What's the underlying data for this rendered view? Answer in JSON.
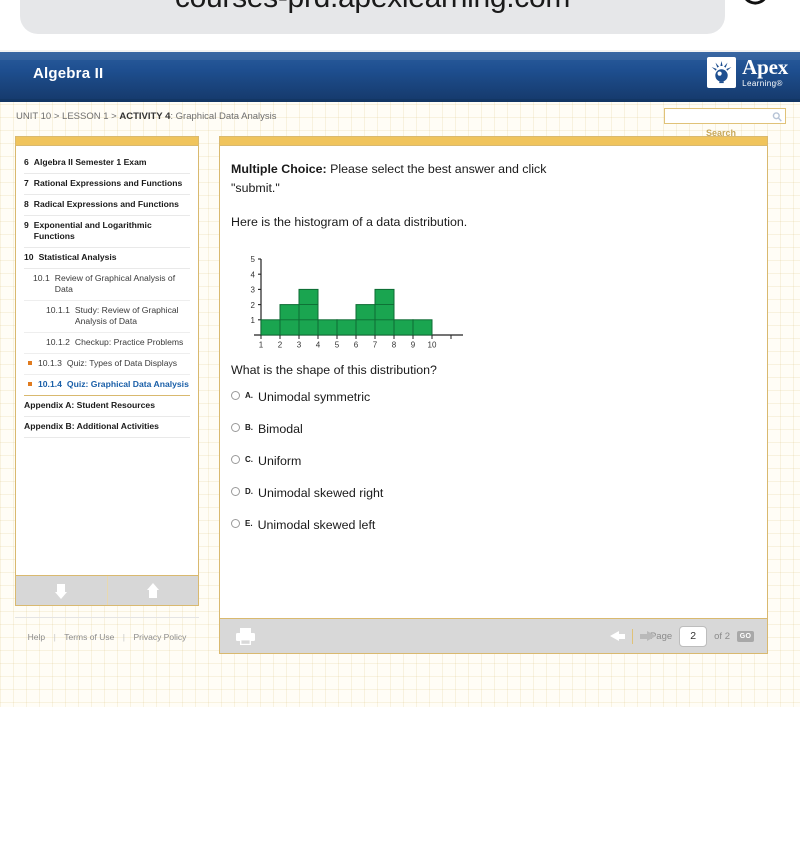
{
  "browser": {
    "url": "courses-prd.apexlearning.com",
    "reload_icon": "reload-icon"
  },
  "header": {
    "course_title": "Algebra II",
    "logo": {
      "mark_icon": "apex-lightbulb-icon",
      "name": "Apex",
      "tagline": "Learning®"
    },
    "colors": {
      "header_blue": "#1e4f90",
      "accent_gold": "#f0c45c",
      "panel_border": "#d9b96f",
      "active_link_blue": "#1a5fa8",
      "bullet_orange": "#e07b1f",
      "bar_green": "#1aa550"
    }
  },
  "breadcrumb": {
    "unit": "UNIT 10",
    "sep1": ">",
    "lesson": "LESSON 1",
    "sep2": ">",
    "activity": "ACTIVITY 4",
    "colon_title": ": Graphical Data Analysis"
  },
  "search": {
    "value": "",
    "placeholder": "",
    "label": "Search",
    "icon": "magnifier-icon"
  },
  "sidebar": {
    "items": [
      {
        "num": "6",
        "label": "Algebra II Semester 1 Exam",
        "level": 1,
        "active": false,
        "marked": false
      },
      {
        "num": "7",
        "label": "Rational Expressions and Functions",
        "level": 1,
        "active": false,
        "marked": false
      },
      {
        "num": "8",
        "label": "Radical Expressions and Functions",
        "level": 1,
        "active": false,
        "marked": false
      },
      {
        "num": "9",
        "label": "Exponential and Logarithmic Functions",
        "level": 1,
        "active": false,
        "marked": false
      },
      {
        "num": "10",
        "label": "Statistical Analysis",
        "level": 1,
        "active": false,
        "marked": false
      },
      {
        "num": "10.1",
        "label": "Review of Graphical Analysis of Data",
        "level": 2,
        "active": false,
        "marked": false
      },
      {
        "num": "10.1.1",
        "label": "Study: Review of Graphical Analysis of Data",
        "level": 3,
        "active": false,
        "marked": false
      },
      {
        "num": "10.1.2",
        "label": "Checkup: Practice Problems",
        "level": 3,
        "active": false,
        "marked": false
      },
      {
        "num": "10.1.3",
        "label": "Quiz: Types of Data Displays",
        "level": 3,
        "active": false,
        "marked": true
      },
      {
        "num": "10.1.4",
        "label": "Quiz: Graphical Data Analysis",
        "level": 3,
        "active": true,
        "marked": true
      },
      {
        "num": "",
        "label": "Appendix A: Student Resources",
        "level": 0,
        "active": false,
        "marked": false
      },
      {
        "num": "",
        "label": "Appendix B: Additional Activities",
        "level": 0,
        "active": false,
        "marked": false
      }
    ],
    "scroll_down_icon": "arrow-down-icon",
    "scroll_up_icon": "arrow-up-icon"
  },
  "footer": {
    "links": [
      "Help",
      "Terms of Use",
      "Privacy Policy"
    ],
    "separator": "|"
  },
  "question": {
    "kind_label": "Multiple Choice:",
    "instruction": " Please select the best answer and click \"submit.\"",
    "intro": "Here is the histogram of a data distribution.",
    "prompt": "What is the shape of this distribution?",
    "choices": [
      {
        "letter": "A.",
        "text": "Unimodal symmetric",
        "selected": false
      },
      {
        "letter": "B.",
        "text": "Bimodal",
        "selected": false
      },
      {
        "letter": "C.",
        "text": "Uniform",
        "selected": false
      },
      {
        "letter": "D.",
        "text": "Unimodal skewed right",
        "selected": false
      },
      {
        "letter": "E.",
        "text": "Unimodal skewed left",
        "selected": false
      }
    ]
  },
  "chart_data": {
    "type": "bar",
    "title": "",
    "xlabel": "",
    "ylabel": "",
    "categories": [
      "1",
      "2",
      "3",
      "4",
      "5",
      "6",
      "7",
      "8",
      "9",
      "10"
    ],
    "values": [
      1,
      2,
      3,
      1,
      1,
      2,
      3,
      1,
      1,
      0
    ],
    "ylim": [
      0,
      5
    ],
    "yticks": [
      1,
      2,
      3,
      4,
      5
    ],
    "xticks": [
      "1",
      "2",
      "3",
      "4",
      "5",
      "6",
      "7",
      "8",
      "9",
      "10"
    ],
    "grid": false,
    "legend": "none",
    "bar_color": "#1aa550",
    "bar_edge_color": "#0d6b33",
    "shape": "bimodal"
  },
  "toolbar": {
    "print_icon": "printer-icon",
    "prev_icon": "arrow-left-icon",
    "next_icon": "arrow-right-icon",
    "page_word": "Page",
    "page_value": "2",
    "of_text": "of 2",
    "go_label": "GO"
  }
}
